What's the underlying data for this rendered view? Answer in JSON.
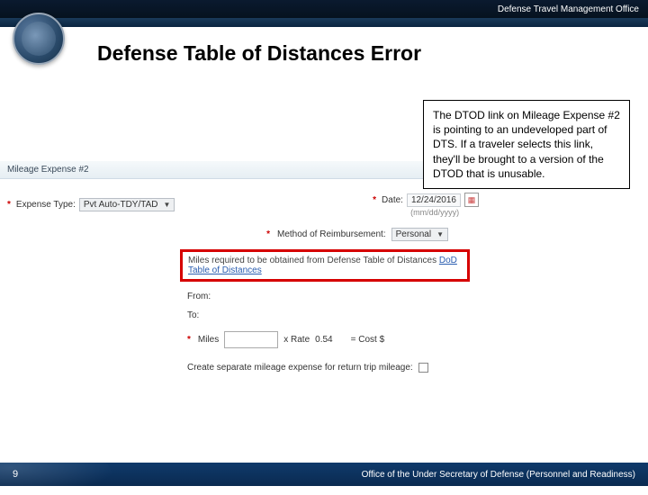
{
  "header": {
    "office": "Defense Travel Management Office"
  },
  "title": "Defense Table of Distances Error",
  "callout": "The DTOD link on Mileage Expense #2 is pointing to an undeveloped part of DTS. If a traveler selects this link, they'll be brought to a version of the DTOD that is unusable.",
  "form": {
    "section": "Mileage Expense #2",
    "expense_type_label": "Expense Type:",
    "expense_type_value": "Pvt Auto-TDY/TAD",
    "date_label": "Date:",
    "date_value": "12/24/2016",
    "date_format": "(mm/dd/yyyy)",
    "mor_label": "Method of Reimbursement:",
    "mor_value": "Personal",
    "highlight_lead": "Miles required to be obtained from Defense Table of Distances ",
    "highlight_link": "DoD Table of Distances",
    "from_label": "From:",
    "to_label": "To:",
    "miles_label": "Miles",
    "miles_value": "",
    "rate_label": "x Rate",
    "rate_value": "0.54",
    "cost_label": "= Cost    $",
    "sep_label": "Create separate mileage expense for return trip mileage:"
  },
  "footer": {
    "page": "9",
    "org": "Office of the Under Secretary of Defense (Personnel and Readiness)"
  }
}
